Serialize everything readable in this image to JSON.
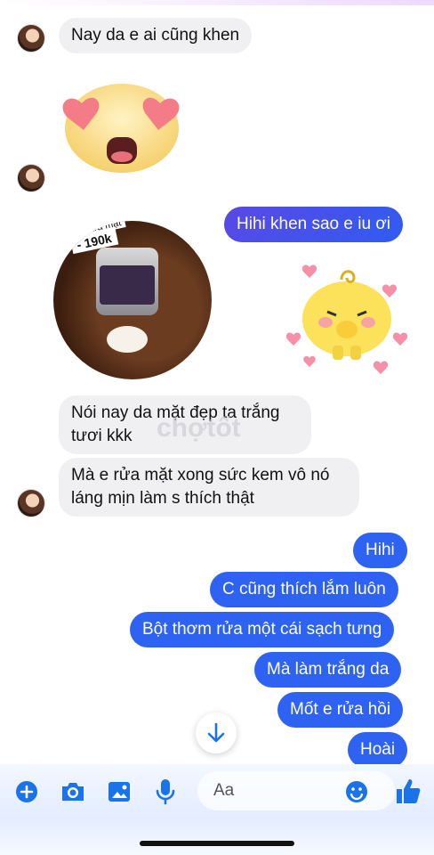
{
  "colors": {
    "outgoing_bubble": "#2e62f3",
    "incoming_bubble": "#f0f0f2",
    "icon_blue": "#1a73e8"
  },
  "messages": {
    "in_1": "Nay da e ai cũng khen",
    "out_1": "Hihi khen sao e iu ơi",
    "in_2_line1": "Nói nay da mặt đẹp ta trắng",
    "in_2_line2": "tươi kkk",
    "in_3_line1": "Mà e rửa mặt xong sức kem vô nó",
    "in_3_line2": "láng mịn làm s thích thật",
    "out_2": "Hihi",
    "out_3": "C cũng thích lắm luôn",
    "out_4": "Bột thơm rửa một cái sạch tưng",
    "out_5": "Mà làm trắng da",
    "out_6": "Mốt e rửa hồi",
    "out_7": "Hoài"
  },
  "photo": {
    "price_label": "- 190k",
    "top_label": "rửa mặt"
  },
  "watermark": "chợtốt",
  "composer": {
    "placeholder": "Aa",
    "icons": [
      "plus-icon",
      "camera-icon",
      "image-icon",
      "microphone-icon",
      "emoji-icon",
      "thumbs-up-icon"
    ]
  }
}
